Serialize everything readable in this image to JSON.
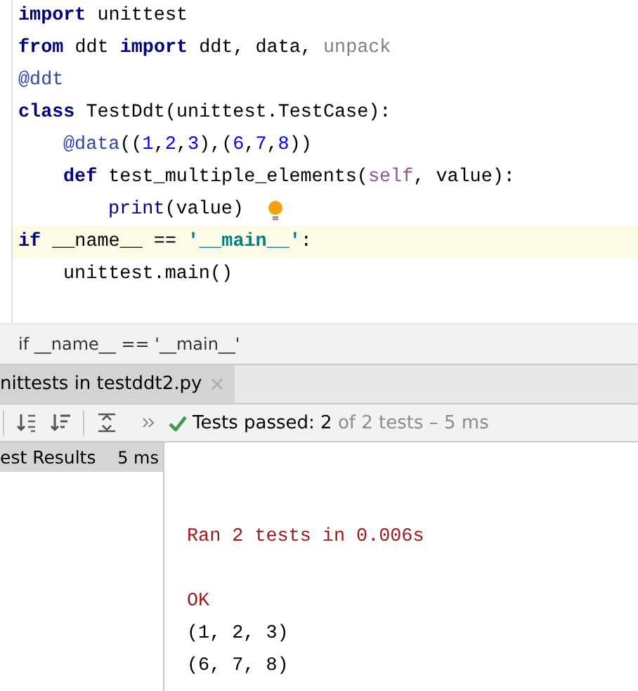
{
  "editor": {
    "lines": [
      {
        "highlighted": false,
        "tokens": [
          {
            "kind": "keyword",
            "text": "import"
          },
          {
            "kind": "plain",
            "text": " unittest"
          }
        ]
      },
      {
        "highlighted": false,
        "tokens": [
          {
            "kind": "keyword",
            "text": "from"
          },
          {
            "kind": "plain",
            "text": " ddt "
          },
          {
            "kind": "keyword",
            "text": "import"
          },
          {
            "kind": "plain",
            "text": " ddt, data, "
          },
          {
            "kind": "unused",
            "text": "unpack"
          }
        ]
      },
      {
        "highlighted": false,
        "tokens": [
          {
            "kind": "decorator",
            "text": "@ddt"
          }
        ]
      },
      {
        "highlighted": false,
        "tokens": [
          {
            "kind": "keyword",
            "text": "class"
          },
          {
            "kind": "plain",
            "text": " TestDdt(unittest.TestCase):"
          }
        ],
        "children": [
          {
            "highlighted": false,
            "tokens": [
              {
                "kind": "decorator",
                "text": "@data"
              },
              {
                "kind": "plain",
                "text": "(("
              },
              {
                "kind": "number",
                "text": "1"
              },
              {
                "kind": "plain",
                "text": ","
              },
              {
                "kind": "number",
                "text": "2"
              },
              {
                "kind": "plain",
                "text": ","
              },
              {
                "kind": "number",
                "text": "3"
              },
              {
                "kind": "plain",
                "text": "),("
              },
              {
                "kind": "number",
                "text": "6"
              },
              {
                "kind": "plain",
                "text": ","
              },
              {
                "kind": "number",
                "text": "7"
              },
              {
                "kind": "plain",
                "text": ","
              },
              {
                "kind": "number",
                "text": "8"
              },
              {
                "kind": "plain",
                "text": "))"
              }
            ]
          },
          {
            "highlighted": false,
            "tokens": [
              {
                "kind": "keyword",
                "text": "def"
              },
              {
                "kind": "plain",
                "text": " test_multiple_elements("
              },
              {
                "kind": "self",
                "text": "self"
              },
              {
                "kind": "plain",
                "text": ", value):"
              }
            ],
            "children": [
              {
                "highlighted": false,
                "hint": true,
                "tokens": [
                  {
                    "kind": "builtin",
                    "text": "print"
                  },
                  {
                    "kind": "plain",
                    "text": "(value)"
                  }
                ]
              }
            ]
          }
        ]
      },
      {
        "highlighted": true,
        "tokens": [
          {
            "kind": "keyword",
            "text": "if"
          },
          {
            "kind": "plain",
            "text": " __name__ == "
          },
          {
            "kind": "string",
            "text": "'__main__'"
          },
          {
            "kind": "plain",
            "text": ":"
          }
        ],
        "children": [
          {
            "highlighted": false,
            "tokens": [
              {
                "kind": "plain",
                "text": "unittest.main()"
              }
            ]
          }
        ]
      }
    ]
  },
  "breadcrumb": "if __name__ == '__main__'",
  "run_tab": {
    "label": "nittests in testddt2.py",
    "selected": true
  },
  "status": {
    "passed": "Tests passed: 2",
    "rest": " of 2 tests – 5 ms"
  },
  "tree": [
    {
      "label": "est Results",
      "time": "5 ms",
      "selected": true
    }
  ],
  "console": [
    {
      "kind": "error",
      "text": "Ran 2 tests in 0.006s"
    },
    {
      "kind": "blank"
    },
    {
      "kind": "error",
      "text": "OK"
    },
    {
      "kind": "out",
      "text": "(1, 2, 3)"
    },
    {
      "kind": "out",
      "text": "(6, 7, 8)"
    }
  ]
}
